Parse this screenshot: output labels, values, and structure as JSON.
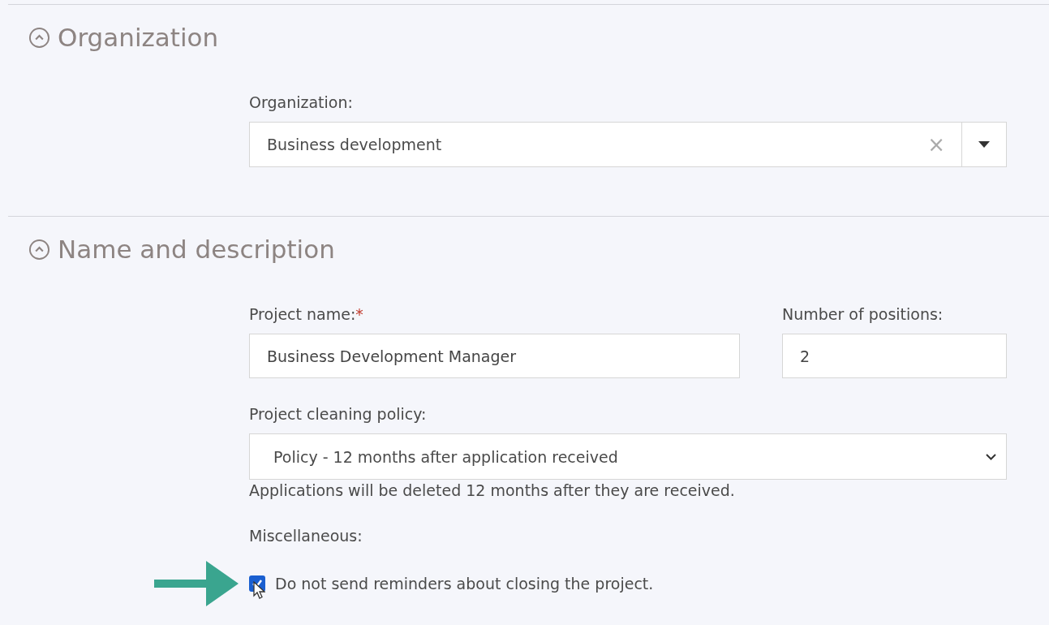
{
  "sections": [
    {
      "title": "Organization",
      "expanded": true,
      "rows": [
        [
          {
            "kind": "combo",
            "label": "Organization:",
            "value": "Business development",
            "clear": "×"
          }
        ]
      ]
    },
    {
      "title": "Name and description",
      "expanded": true,
      "rows": [
        [
          {
            "kind": "text",
            "label": "Project name:",
            "required_mark": "*",
            "value": "Business Development Manager"
          },
          {
            "kind": "text",
            "label": "Number of positions:",
            "value": "2"
          }
        ],
        [
          {
            "kind": "select",
            "label": "Project cleaning policy:",
            "value": "Policy - 12 months after application received",
            "help": "Applications will be deleted 12 months after they are received."
          }
        ],
        [
          {
            "kind": "caption",
            "label": "Miscellaneous:"
          }
        ],
        [
          {
            "kind": "checkbox",
            "label": "Do not send reminders about closing the project.",
            "checked": true,
            "pointer": true
          }
        ]
      ]
    }
  ]
}
